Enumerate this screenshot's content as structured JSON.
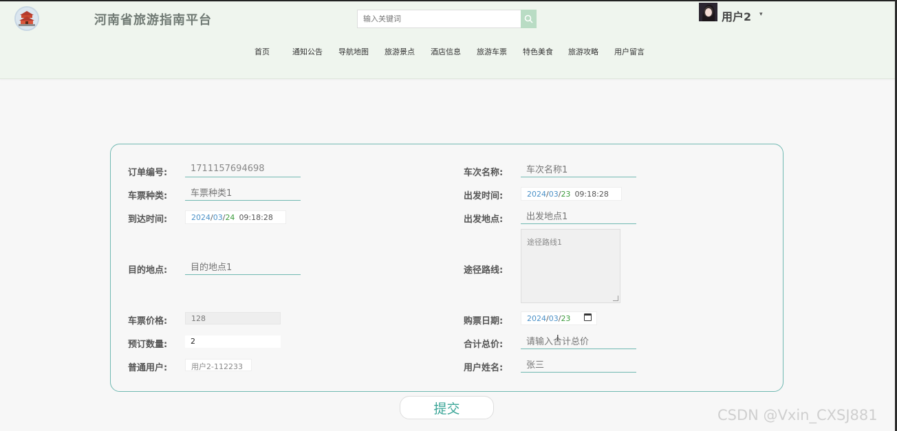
{
  "header": {
    "site_title": "河南省旅游指南平台",
    "search_placeholder": "输入关键词",
    "user_name": "用户2",
    "caret": "▾"
  },
  "nav": {
    "items": [
      "首页",
      "通知公告",
      "导航地图",
      "旅游景点",
      "酒店信息",
      "旅游车票",
      "特色美食",
      "旅游攻略",
      "用户留言"
    ]
  },
  "form": {
    "order_no": {
      "label": "订单编号:",
      "value": "1711157694698"
    },
    "train_name": {
      "label": "车次名称:",
      "placeholder": "车次名称1"
    },
    "ticket_type": {
      "label": "车票种类:",
      "placeholder": "车票种类1"
    },
    "depart_time": {
      "label": "出发时间:",
      "year": "2024",
      "month": "03",
      "day": "23",
      "time": "09:18:28"
    },
    "arrive_time": {
      "label": "到达时间:",
      "year": "2024",
      "month": "03",
      "day": "24",
      "time": "09:18:28"
    },
    "depart_place": {
      "label": "出发地点:",
      "placeholder": "出发地点1"
    },
    "destination": {
      "label": "目的地点:",
      "placeholder": "目的地点1"
    },
    "route": {
      "label": "途径路线:",
      "placeholder": "途径路线1"
    },
    "price": {
      "label": "车票价格:",
      "value": "128"
    },
    "purchase_date": {
      "label": "购票日期:",
      "year": "2024",
      "month": "03",
      "day": "23"
    },
    "quantity": {
      "label": "预订数量:",
      "value": "2"
    },
    "total": {
      "label": "合计总价:",
      "placeholder": "请输入合计总价"
    },
    "user": {
      "label": "普通用户:",
      "value": "用户2-112233"
    },
    "real_name": {
      "label": "用户姓名:",
      "placeholder": "张三"
    },
    "date_sep": "/",
    "submit_label": "提交"
  },
  "watermark": "CSDN @Vxin_CXSJ881",
  "colors": {
    "accent": "#6fb8b1",
    "header_bg": "#eff5ee",
    "search_btn": "#b9dcc4",
    "submit_text": "#3aa597"
  }
}
